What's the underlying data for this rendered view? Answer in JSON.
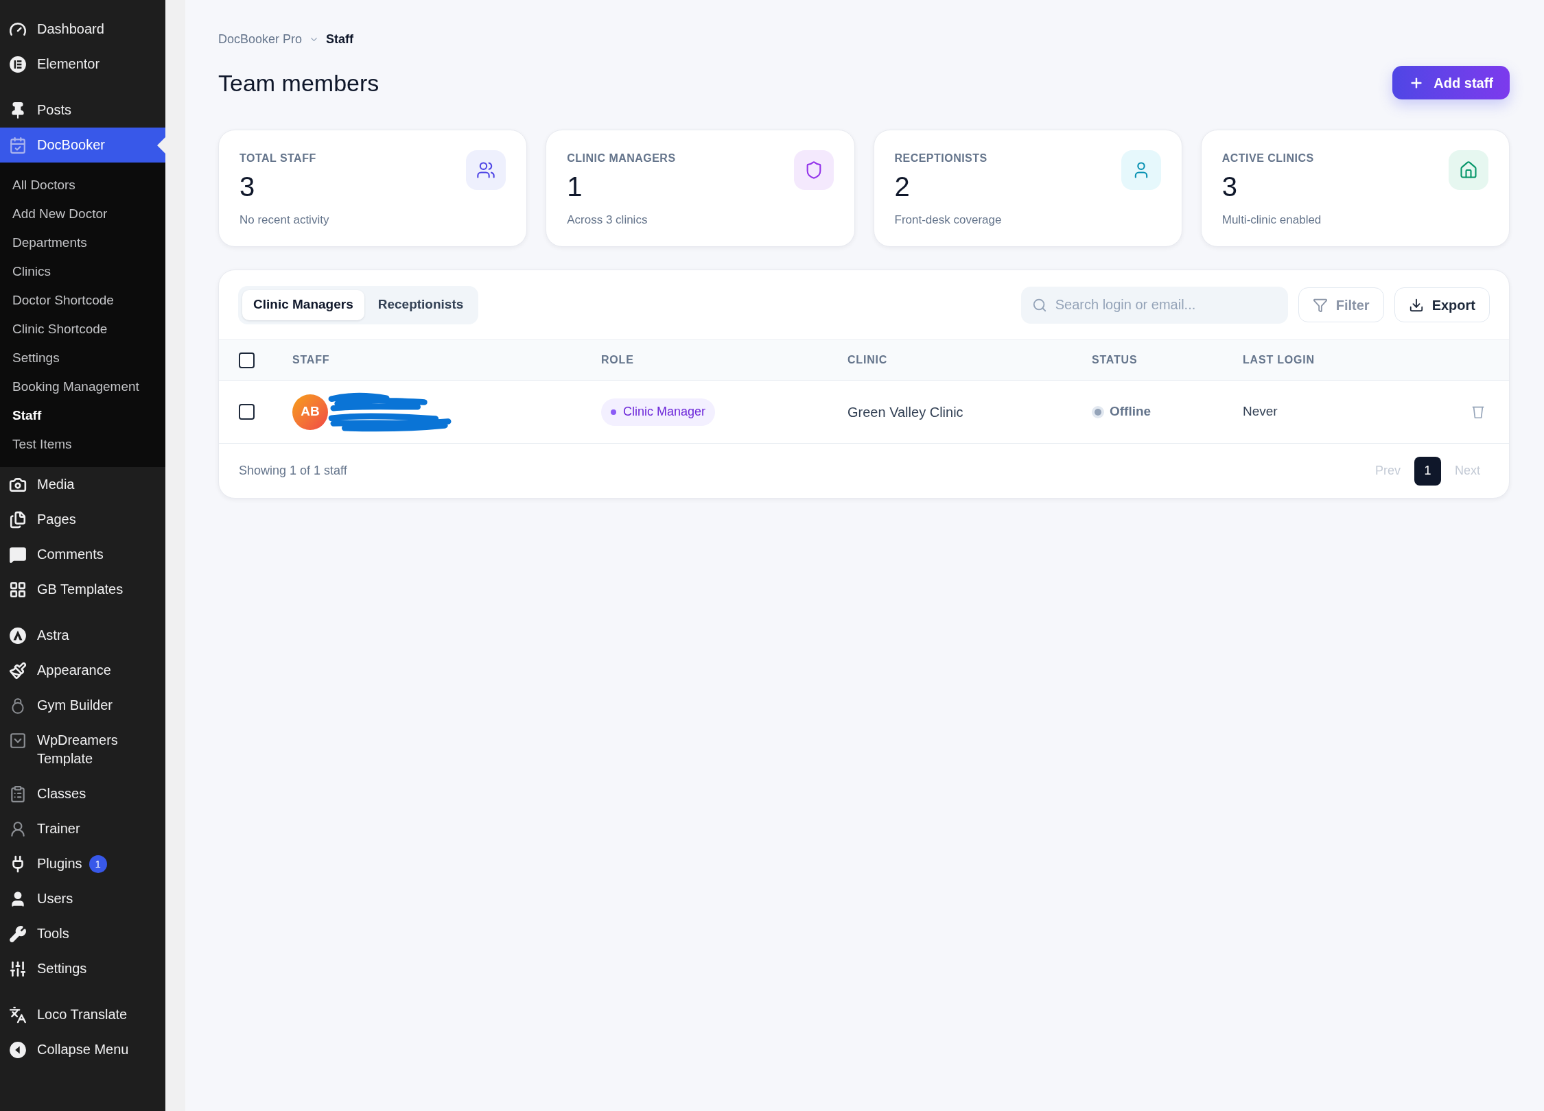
{
  "sidebar": {
    "groups": [
      {
        "items": [
          {
            "label": "Dashboard",
            "selected": false
          },
          {
            "label": "Elementor",
            "selected": false
          }
        ]
      },
      {
        "items": [
          {
            "label": "Posts",
            "selected": false
          },
          {
            "label": "DocBooker",
            "selected": true,
            "children": [
              {
                "label": "All Doctors",
                "selected": false
              },
              {
                "label": "Add New Doctor",
                "selected": false
              },
              {
                "label": "Departments",
                "selected": false
              },
              {
                "label": "Clinics",
                "selected": false
              },
              {
                "label": "Doctor Shortcode",
                "selected": false
              },
              {
                "label": "Clinic Shortcode",
                "selected": false
              },
              {
                "label": "Settings",
                "selected": false
              },
              {
                "label": "Booking Management",
                "selected": false
              },
              {
                "label": "Staff",
                "selected": true
              },
              {
                "label": "Test Items",
                "selected": false
              }
            ]
          },
          {
            "label": "Media",
            "selected": false
          },
          {
            "label": "Pages",
            "selected": false
          },
          {
            "label": "Comments",
            "selected": false
          },
          {
            "label": "GB Templates",
            "selected": false
          }
        ]
      },
      {
        "items": [
          {
            "label": "Astra",
            "selected": false
          },
          {
            "label": "Appearance",
            "selected": false
          },
          {
            "label": "Gym Builder",
            "selected": false
          },
          {
            "label": "WpDreamers Template",
            "selected": false
          },
          {
            "label": "Classes",
            "selected": false
          },
          {
            "label": "Trainer",
            "selected": false
          },
          {
            "label": "Plugins",
            "selected": false,
            "badge": "1"
          },
          {
            "label": "Users",
            "selected": false
          },
          {
            "label": "Tools",
            "selected": false
          },
          {
            "label": "Settings",
            "selected": false
          }
        ]
      },
      {
        "items": [
          {
            "label": "Loco Translate",
            "selected": false
          },
          {
            "label": "Collapse Menu",
            "selected": false
          }
        ]
      }
    ]
  },
  "breadcrumb": [
    "DocBooker Pro",
    "Staff"
  ],
  "page_title": "Team members",
  "add_button": "Add staff",
  "stats": [
    {
      "label": "TOTAL STAFF",
      "value": "3",
      "note": "No recent activity"
    },
    {
      "label": "CLINIC MANAGERS",
      "value": "1",
      "note": "Across 3 clinics"
    },
    {
      "label": "RECEPTIONISTS",
      "value": "2",
      "note": "Front-desk coverage"
    },
    {
      "label": "ACTIVE CLINICS",
      "value": "3",
      "note": "Multi-clinic enabled"
    }
  ],
  "staff_panel": {
    "tabs": [
      {
        "label": "Clinic Managers",
        "selected": true
      },
      {
        "label": "Receptionists",
        "selected": false
      }
    ],
    "search": {
      "placeholder": "Search login or email..."
    },
    "actions": [
      {
        "kind": "filter",
        "label": "Filter"
      },
      {
        "kind": "export",
        "label": "Export"
      }
    ],
    "table": {
      "select_all_checked": false,
      "columns": [
        "STAFF",
        "ROLE",
        "CLINIC",
        "STATUS",
        "LAST LOGIN"
      ],
      "rows": [
        {
          "checked": false,
          "initials": "AB",
          "role": "Clinic Manager",
          "clinic": "Green Valley Clinic",
          "status": "Offline",
          "online": false,
          "last_login": "Never"
        }
      ]
    },
    "footer": "Showing 1 of 1 staff",
    "pagination": {
      "prev": {
        "label": "Prev",
        "disabled": true
      },
      "pages": [
        {
          "label": "1",
          "selected": true
        }
      ],
      "next": {
        "label": "Next",
        "disabled": true
      }
    }
  }
}
